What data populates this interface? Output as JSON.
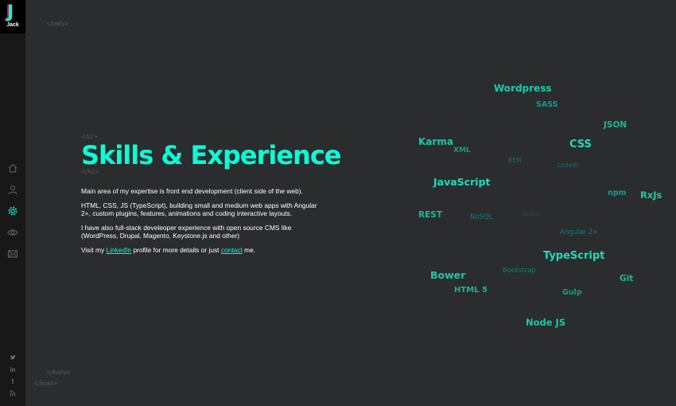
{
  "sidebar": {
    "logo_letter": "J",
    "logo_name": "Jack",
    "nav": [
      {
        "name": "nav-home",
        "icon": "home-icon"
      },
      {
        "name": "nav-about",
        "icon": "user-icon"
      },
      {
        "name": "nav-skills",
        "icon": "gear-icon"
      },
      {
        "name": "nav-work",
        "icon": "eye-icon"
      },
      {
        "name": "nav-contact",
        "icon": "envelope-icon"
      }
    ],
    "social": [
      {
        "name": "twitter-link",
        "icon": "twitter-icon"
      },
      {
        "name": "linkedin-link",
        "icon": "linkedin-icon",
        "label": "in"
      },
      {
        "name": "facebook-link",
        "icon": "facebook-icon",
        "label": "f"
      },
      {
        "name": "rss-link",
        "icon": "rss-icon"
      }
    ]
  },
  "decor": {
    "body_open": "<body>",
    "h2_open": "<h2>",
    "h2_close": "</h2>",
    "body_close": "</body>",
    "html_close": "</html>"
  },
  "main": {
    "heading": "Skills & Experience",
    "paragraph1": "Main area of my expertise is front end development (client side of the web).",
    "paragraph2": "HTML, CSS, JS (TypeScript), building small and medium web apps with Angular 2+, custom plugins, features, animations and coding interactive layouts.",
    "paragraph3": "I have also full-stack develeoper experience with open source CMS like (WordPress, Drupal, Magento, Keystone.js and other)",
    "paragraph4": {
      "prefix": "Visit my ",
      "link1": "LinkedIn",
      "middle": " profile for more details or just ",
      "link2": "contact",
      "suffix": " me."
    }
  },
  "word_cloud": [
    {
      "text": "Wordpress",
      "color": "#1cc9a8"
    },
    {
      "text": "SASS",
      "color": "#139e87"
    },
    {
      "text": "JSON",
      "color": "#17b799"
    },
    {
      "text": "Karma",
      "color": "#1cc9a8"
    },
    {
      "text": "XML",
      "color": "#139e87"
    },
    {
      "text": "CSS",
      "color": "#1fdcbb"
    },
    {
      "text": "BEM",
      "color": "#0f7466"
    },
    {
      "text": "Lodash",
      "color": "#0f7466"
    },
    {
      "text": "JavaScript",
      "color": "#1fdcbb"
    },
    {
      "text": "npm",
      "color": "#139e87"
    },
    {
      "text": "RxJs",
      "color": "#1cc9a8"
    },
    {
      "text": "REST",
      "color": "#17b799"
    },
    {
      "text": "NoSQL",
      "color": "#10806f"
    },
    {
      "text": "jQuery",
      "color": "#0c5a50"
    },
    {
      "text": "Angular 2+",
      "color": "#10806f"
    },
    {
      "text": "TypeScript",
      "color": "#1fdcbb"
    },
    {
      "text": "Bower",
      "color": "#1cc9a8"
    },
    {
      "text": "Bootstrap",
      "color": "#10806f"
    },
    {
      "text": "Git",
      "color": "#17b799"
    },
    {
      "text": "HTML 5",
      "color": "#17b799"
    },
    {
      "text": "Gulp",
      "color": "#139e87"
    },
    {
      "text": "Node JS",
      "color": "#1cc9a8"
    }
  ]
}
